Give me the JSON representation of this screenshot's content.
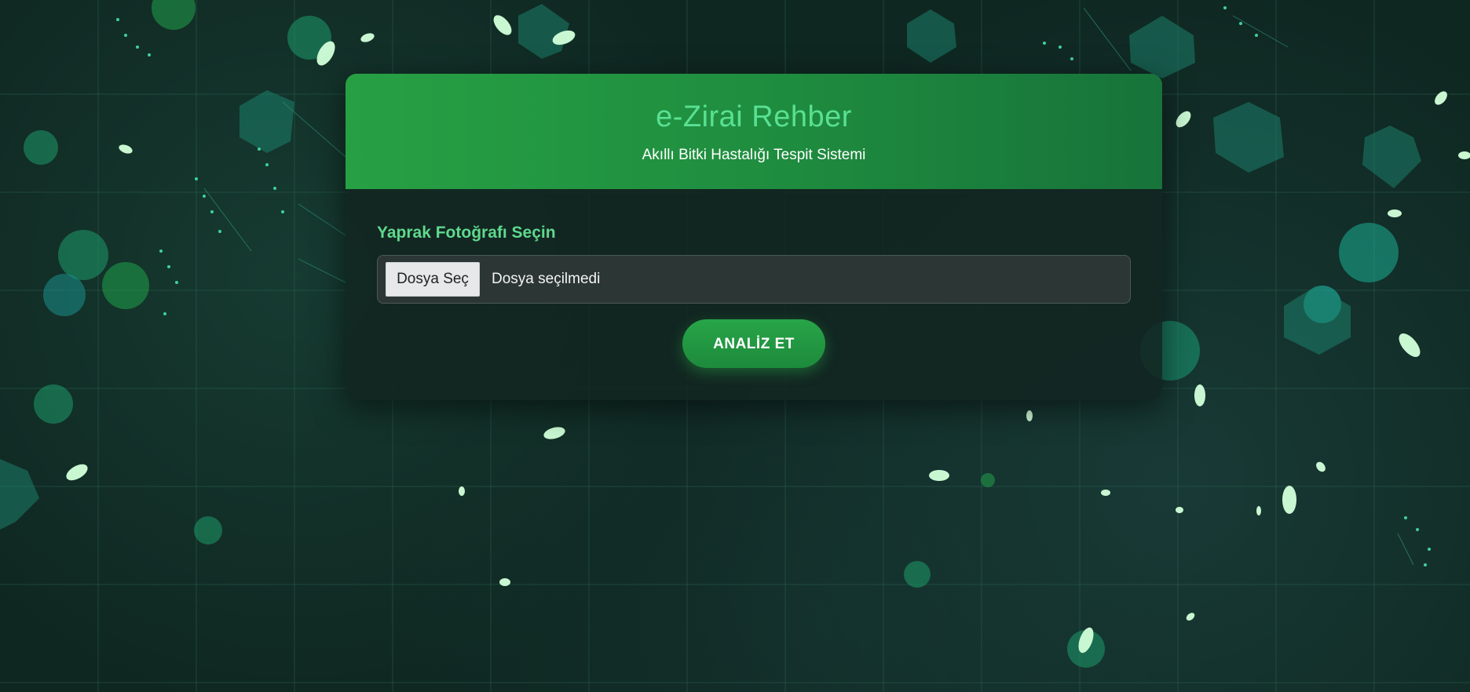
{
  "header": {
    "title": "e-Zirai Rehber",
    "subtitle": "Akıllı Bitki Hastalığı Tespit Sistemi"
  },
  "form": {
    "field_label": "Yaprak Fotoğrafı Seçin",
    "file_button_label": "Dosya Seç",
    "file_status": "Dosya seçilmedi",
    "submit_label": "ANALİZ ET"
  },
  "colors": {
    "background": "#0f2721",
    "header_gradient_start": "#27a044",
    "header_gradient_end": "#17733a",
    "title": "#59e093",
    "accent_label": "#5fd98d",
    "button": "#28a548"
  }
}
